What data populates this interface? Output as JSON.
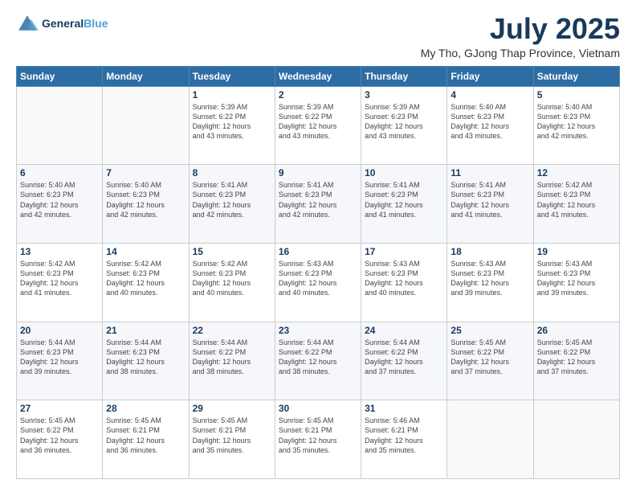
{
  "logo": {
    "line1": "General",
    "line2": "Blue"
  },
  "title": "July 2025",
  "subtitle": "My Tho, GJong Thap Province, Vietnam",
  "days_of_week": [
    "Sunday",
    "Monday",
    "Tuesday",
    "Wednesday",
    "Thursday",
    "Friday",
    "Saturday"
  ],
  "weeks": [
    [
      {
        "num": "",
        "info": ""
      },
      {
        "num": "",
        "info": ""
      },
      {
        "num": "1",
        "info": "Sunrise: 5:39 AM\nSunset: 6:22 PM\nDaylight: 12 hours\nand 43 minutes."
      },
      {
        "num": "2",
        "info": "Sunrise: 5:39 AM\nSunset: 6:22 PM\nDaylight: 12 hours\nand 43 minutes."
      },
      {
        "num": "3",
        "info": "Sunrise: 5:39 AM\nSunset: 6:23 PM\nDaylight: 12 hours\nand 43 minutes."
      },
      {
        "num": "4",
        "info": "Sunrise: 5:40 AM\nSunset: 6:23 PM\nDaylight: 12 hours\nand 43 minutes."
      },
      {
        "num": "5",
        "info": "Sunrise: 5:40 AM\nSunset: 6:23 PM\nDaylight: 12 hours\nand 42 minutes."
      }
    ],
    [
      {
        "num": "6",
        "info": "Sunrise: 5:40 AM\nSunset: 6:23 PM\nDaylight: 12 hours\nand 42 minutes."
      },
      {
        "num": "7",
        "info": "Sunrise: 5:40 AM\nSunset: 6:23 PM\nDaylight: 12 hours\nand 42 minutes."
      },
      {
        "num": "8",
        "info": "Sunrise: 5:41 AM\nSunset: 6:23 PM\nDaylight: 12 hours\nand 42 minutes."
      },
      {
        "num": "9",
        "info": "Sunrise: 5:41 AM\nSunset: 6:23 PM\nDaylight: 12 hours\nand 42 minutes."
      },
      {
        "num": "10",
        "info": "Sunrise: 5:41 AM\nSunset: 6:23 PM\nDaylight: 12 hours\nand 41 minutes."
      },
      {
        "num": "11",
        "info": "Sunrise: 5:41 AM\nSunset: 6:23 PM\nDaylight: 12 hours\nand 41 minutes."
      },
      {
        "num": "12",
        "info": "Sunrise: 5:42 AM\nSunset: 6:23 PM\nDaylight: 12 hours\nand 41 minutes."
      }
    ],
    [
      {
        "num": "13",
        "info": "Sunrise: 5:42 AM\nSunset: 6:23 PM\nDaylight: 12 hours\nand 41 minutes."
      },
      {
        "num": "14",
        "info": "Sunrise: 5:42 AM\nSunset: 6:23 PM\nDaylight: 12 hours\nand 40 minutes."
      },
      {
        "num": "15",
        "info": "Sunrise: 5:42 AM\nSunset: 6:23 PM\nDaylight: 12 hours\nand 40 minutes."
      },
      {
        "num": "16",
        "info": "Sunrise: 5:43 AM\nSunset: 6:23 PM\nDaylight: 12 hours\nand 40 minutes."
      },
      {
        "num": "17",
        "info": "Sunrise: 5:43 AM\nSunset: 6:23 PM\nDaylight: 12 hours\nand 40 minutes."
      },
      {
        "num": "18",
        "info": "Sunrise: 5:43 AM\nSunset: 6:23 PM\nDaylight: 12 hours\nand 39 minutes."
      },
      {
        "num": "19",
        "info": "Sunrise: 5:43 AM\nSunset: 6:23 PM\nDaylight: 12 hours\nand 39 minutes."
      }
    ],
    [
      {
        "num": "20",
        "info": "Sunrise: 5:44 AM\nSunset: 6:23 PM\nDaylight: 12 hours\nand 39 minutes."
      },
      {
        "num": "21",
        "info": "Sunrise: 5:44 AM\nSunset: 6:23 PM\nDaylight: 12 hours\nand 38 minutes."
      },
      {
        "num": "22",
        "info": "Sunrise: 5:44 AM\nSunset: 6:22 PM\nDaylight: 12 hours\nand 38 minutes."
      },
      {
        "num": "23",
        "info": "Sunrise: 5:44 AM\nSunset: 6:22 PM\nDaylight: 12 hours\nand 38 minutes."
      },
      {
        "num": "24",
        "info": "Sunrise: 5:44 AM\nSunset: 6:22 PM\nDaylight: 12 hours\nand 37 minutes."
      },
      {
        "num": "25",
        "info": "Sunrise: 5:45 AM\nSunset: 6:22 PM\nDaylight: 12 hours\nand 37 minutes."
      },
      {
        "num": "26",
        "info": "Sunrise: 5:45 AM\nSunset: 6:22 PM\nDaylight: 12 hours\nand 37 minutes."
      }
    ],
    [
      {
        "num": "27",
        "info": "Sunrise: 5:45 AM\nSunset: 6:22 PM\nDaylight: 12 hours\nand 36 minutes."
      },
      {
        "num": "28",
        "info": "Sunrise: 5:45 AM\nSunset: 6:21 PM\nDaylight: 12 hours\nand 36 minutes."
      },
      {
        "num": "29",
        "info": "Sunrise: 5:45 AM\nSunset: 6:21 PM\nDaylight: 12 hours\nand 35 minutes."
      },
      {
        "num": "30",
        "info": "Sunrise: 5:45 AM\nSunset: 6:21 PM\nDaylight: 12 hours\nand 35 minutes."
      },
      {
        "num": "31",
        "info": "Sunrise: 5:46 AM\nSunset: 6:21 PM\nDaylight: 12 hours\nand 35 minutes."
      },
      {
        "num": "",
        "info": ""
      },
      {
        "num": "",
        "info": ""
      }
    ]
  ]
}
